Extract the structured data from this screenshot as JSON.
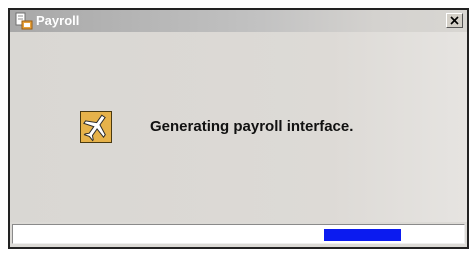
{
  "window": {
    "title": "Payroll",
    "close_symbol": "×",
    "icons": {
      "app": "payroll-app-icon",
      "close": "close-icon",
      "status": "airplane-icon"
    }
  },
  "message": "Generating payroll interface.",
  "progress": {
    "mode": "indeterminate",
    "block_start_fraction": 0.69,
    "block_width_fraction": 0.17,
    "color": "#0b1bf0"
  },
  "colors": {
    "dialog_background": "#dcdad6",
    "title_text": "#ffffff",
    "icon_background": "#e6b24a"
  }
}
